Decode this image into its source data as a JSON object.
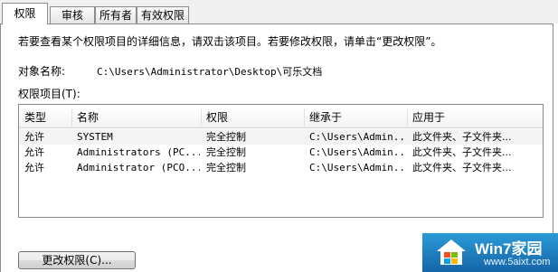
{
  "tabs": [
    "权限",
    "审核",
    "所有者",
    "有效权限"
  ],
  "instruction": "若要查看某个权限项目的详细信息，请双击该项目。若要修改权限，请单击“更改权限”。",
  "object_label": "对象名称:",
  "object_value": "C:\\Users\\Administrator\\Desktop\\可乐文档",
  "entries_label": "权限项目(T):",
  "columns": [
    "类型",
    "名称",
    "权限",
    "继承于",
    "应用于"
  ],
  "rows": [
    {
      "type": "允许",
      "name": "SYSTEM",
      "perm": "完全控制",
      "inherit": "C:\\Users\\Admin...",
      "apply": "此文件夹、子文件夹..."
    },
    {
      "type": "允许",
      "name": "Administrators (PC...",
      "perm": "完全控制",
      "inherit": "C:\\Users\\Admin...",
      "apply": "此文件夹、子文件夹..."
    },
    {
      "type": "允许",
      "name": "Administrator (PCO...",
      "perm": "完全控制",
      "inherit": "C:\\Users\\Admin...",
      "apply": "此文件夹、子文件夹..."
    }
  ],
  "change_button": "更改权限(C)...",
  "watermark": {
    "title": "Win7家园",
    "url": "www.5aixt.com"
  }
}
